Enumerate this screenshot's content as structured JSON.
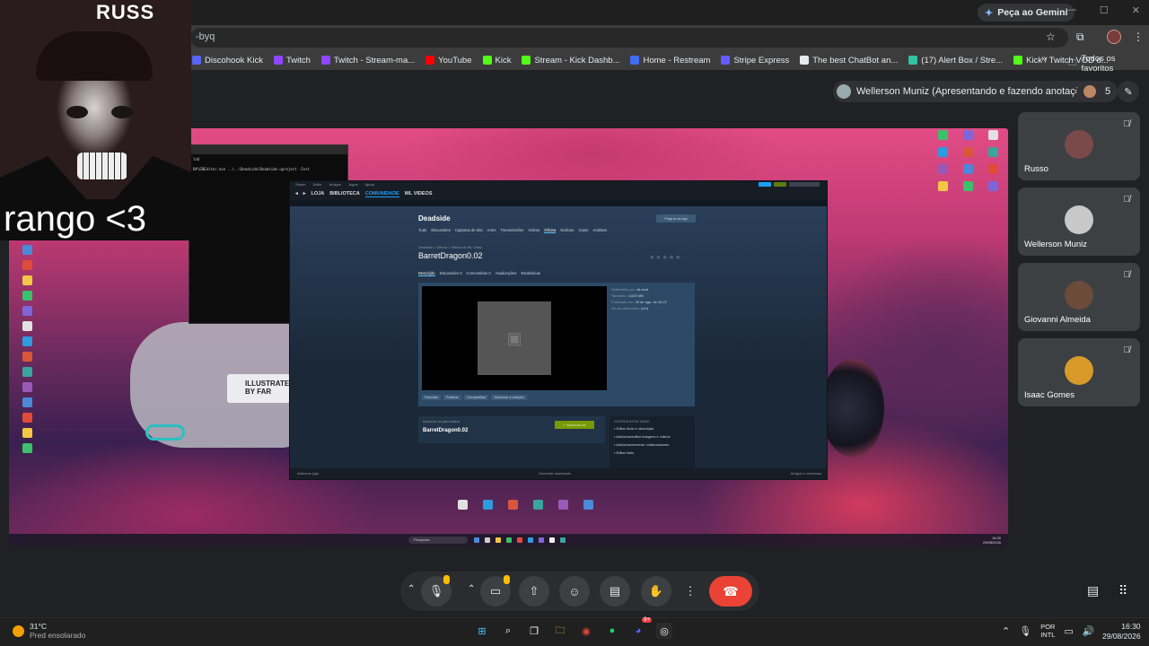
{
  "browser": {
    "gemini_label": "Peça ao Gemini",
    "url_fragment": "-byq",
    "bookmarks": [
      {
        "label": "Discohook Kick",
        "color": "#5865f2"
      },
      {
        "label": "Twitch",
        "color": "#9146ff"
      },
      {
        "label": "Twitch - Stream-ma...",
        "color": "#9146ff"
      },
      {
        "label": "YouTube",
        "color": "#ff0000"
      },
      {
        "label": "Kick",
        "color": "#53fc18"
      },
      {
        "label": "Stream - Kick Dashb...",
        "color": "#53fc18"
      },
      {
        "label": "Home - Restream",
        "color": "#3f6cf4"
      },
      {
        "label": "Stripe Express",
        "color": "#635bff"
      },
      {
        "label": "The best ChatBot an...",
        "color": "#e8eaed"
      },
      {
        "label": "(17) Alert Box / Stre...",
        "color": "#31c3a2"
      },
      {
        "label": "Kick / Twitch VOD d...",
        "color": "#53fc18"
      }
    ],
    "bookmarks_more": "»",
    "all_bookmarks": "Todos os favoritos"
  },
  "meet": {
    "presenter_chip": "Wellerson Muniz (Apresentando e fazendo anotações)",
    "participant_count": "5",
    "participants": [
      {
        "name": "Russo",
        "avatar_color": "#7a4a4a"
      },
      {
        "name": "Wellerson Muniz",
        "avatar_color": "#c8c8c8"
      },
      {
        "name": "Giovanni Almeida",
        "avatar_color": "#6b4b3a"
      },
      {
        "name": "Isaac Gomes",
        "avatar_color": "#d79a2a"
      }
    ],
    "end_call_color": "#ea4335"
  },
  "webcam": {
    "logo": "RUSS",
    "caption": "rango <3"
  },
  "shared_screen": {
    "terminal_line": "D#\\EBEditor.exe ..\\..\\Deadside\\Deadside.uproject -Inst",
    "terminal_line_top": "ld4",
    "steam": {
      "menu": [
        "Steam",
        "Exibir",
        "Amigos",
        "Jogos",
        "Ajuda"
      ],
      "nav": [
        "LOJA",
        "BIBLIOTECA",
        "COMUNIDADE",
        "WL VIDEOS"
      ],
      "nav_active": "COMUNIDADE",
      "game_title": "Deadside",
      "store_button": "Página na loja",
      "game_tabs": [
        "Tudo",
        "Discussões",
        "Capturas de tela",
        "Artes",
        "Transmissões",
        "Vídeos",
        "Oficina",
        "Notícias",
        "Guias",
        "Análises"
      ],
      "game_tab_active": "Oficina",
      "breadcrumb": "Deadside > Oficina > Oficina de WL Video",
      "item_title": "BarretDragon0.02",
      "item_tabs": [
        "Descrição",
        "Discussões 0",
        "Comentários 0",
        "Atualizações",
        "Estatísticas"
      ],
      "item_tab_active": "Descrição",
      "actions": [
        "Favoritar",
        "Publicar",
        "Compartilhar",
        "Adicionar à coleção"
      ],
      "meta": [
        {
          "k": "Submetido por:",
          "v": "dk-rival"
        },
        {
          "k": "Tamanho:",
          "v": "4,525 MB"
        },
        {
          "k": "Publicado em:",
          "v": "29 de ago. às 16:22"
        },
        {
          "k": "Ver as alterações:",
          "v": "(ver)"
        }
      ],
      "subscribe_small": "Inscrever-se para baixar",
      "subscribe_name": "BarretDragon0.02",
      "subscribe_button": "+ Inscrever-se",
      "owner_header": "CONTROLES DO DONO",
      "owner_controls": [
        "Editar título e descrição",
        "Adicionar/editar imagens e vídeos",
        "Adicionar/remover colaboradores",
        "Editar links"
      ],
      "status_left": "Adicionar jogo",
      "status_mid": "Gerenciar downloads",
      "status_right": "Amigos e conversas"
    },
    "inner_taskbar": {
      "search": "Pesquisar",
      "clock_time": "16:30",
      "clock_date": "29/08/2026"
    }
  },
  "taskbar": {
    "weather_temp": "31°C",
    "weather_desc": "Pred ensolarado",
    "lang_top": "POR",
    "lang_bottom": "INTL",
    "time": "16:30",
    "date": "29/08/2026",
    "discord_badge": "9+"
  }
}
